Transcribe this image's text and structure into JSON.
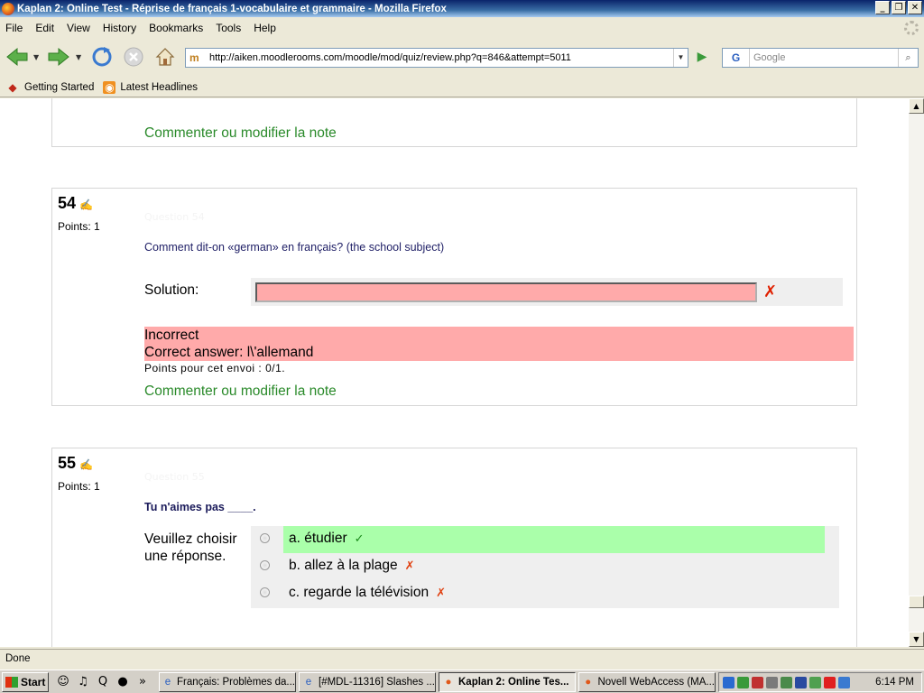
{
  "window": {
    "title": "Kaplan 2: Online Test - Réprise de français 1-vocabulaire et grammaire - Mozilla Firefox",
    "buttons": {
      "minimize": "_",
      "maximize": "❐",
      "close": "✕"
    }
  },
  "menu": [
    {
      "label": "File",
      "accel": "F"
    },
    {
      "label": "Edit",
      "accel": "E"
    },
    {
      "label": "View",
      "accel": "V"
    },
    {
      "label": "History",
      "accel": "H"
    },
    {
      "label": "Bookmarks",
      "accel": "B"
    },
    {
      "label": "Tools",
      "accel": "T"
    },
    {
      "label": "Help",
      "accel": "H"
    }
  ],
  "nav": {
    "url": "http://aiken.moodlerooms.com/moodle/mod/quiz/review.php?q=846&attempt=5011",
    "search_placeholder": "Google",
    "search_engine": "G"
  },
  "bookmarks": [
    {
      "label": "Getting Started",
      "icon": "firefox-icon"
    },
    {
      "label": "Latest Headlines",
      "icon": "rss-icon"
    }
  ],
  "page": {
    "prev_comment": "Commenter ou modifier la note",
    "q54": {
      "number": "54",
      "points": "Points: 1",
      "hidden_label": "Question 54",
      "text": "Comment dit-on «german» en français? (the school subject)",
      "solution_label": "Solution:",
      "solution_value": "",
      "feedback_status": "Incorrect",
      "correct_answer": "Correct answer: l\\'allemand",
      "points_envoi": "Points pour cet envoi : 0/1.",
      "comment": "Commenter ou modifier la note"
    },
    "q55": {
      "number": "55",
      "points": "Points: 1",
      "hidden_label": "Question 55",
      "text": "Tu n'aimes pas ____.",
      "choose_line1": "Veuillez choisir",
      "choose_line2": "une réponse.",
      "answers": [
        {
          "label": "a. étudier",
          "mark": "✓",
          "status": "correct"
        },
        {
          "label": "b. allez à la plage",
          "mark": "✗",
          "status": "wrong"
        },
        {
          "label": "c. regarde la télévision",
          "mark": "✗",
          "status": "wrong"
        }
      ]
    }
  },
  "status": "Done",
  "taskbar": {
    "start": "Start",
    "tasks": [
      {
        "label": "Français: Problèmes da...",
        "active": false
      },
      {
        "label": "[#MDL-11316] Slashes ...",
        "active": false
      },
      {
        "label": "Kaplan 2: Online Tes...",
        "active": true
      },
      {
        "label": "Novell WebAccess (MA...",
        "active": false
      }
    ],
    "clock": "6:14 PM"
  },
  "colors": {
    "correct_bg": "#aaffaa",
    "incorrect_bg": "#ffaaaa",
    "comment_link": "#2a8a2a"
  }
}
